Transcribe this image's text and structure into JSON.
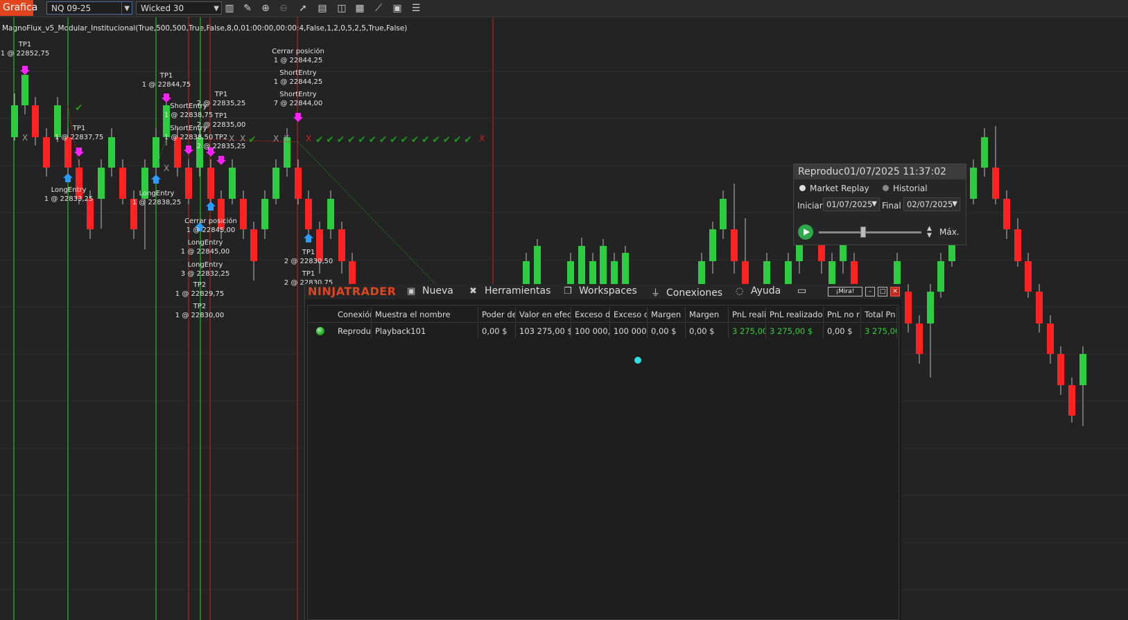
{
  "toolbar": {
    "tab_label": "Grafica",
    "instrument": "NQ 09-25",
    "bar_type": "Wicked 30",
    "icons": [
      "bar-type-icon",
      "draw-pencil-icon",
      "zoom-in-icon",
      "zoom-out-icon",
      "pointer-icon",
      "data-box-icon",
      "templates-icon",
      "properties-icon",
      "indicators-icon",
      "strategies-icon",
      "list-icon"
    ]
  },
  "chart": {
    "indicator_label": "MagnoFlux_v5_Modular_Institucional(True,500,500,True,False,8,0,01:00:00,00:00:4,False,1,2,0,5,2,5,True,False)",
    "colors": {
      "up": "#2ecc40",
      "down": "#ff2222",
      "bg": "#232323",
      "green_line": "#22dd22",
      "red_line": "#cc2222",
      "trail": "#1a8a1a"
    },
    "annotations": [
      {
        "id": "a1",
        "lines": [
          "TP1",
          "1 @ 22852,75"
        ]
      },
      {
        "id": "a2",
        "lines": [
          "TP1",
          "1 @ 22844,75"
        ]
      },
      {
        "id": "a3",
        "lines": [
          "TP1",
          "1 @ 22837,75"
        ]
      },
      {
        "id": "a4",
        "lines": [
          "LongEntry",
          "1 @ 22833,25"
        ]
      },
      {
        "id": "a5",
        "lines": [
          "LongEntry",
          "1 @ 22838,25"
        ]
      },
      {
        "id": "a6",
        "lines": [
          "ShortEntry",
          "1 @ 22838,75"
        ]
      },
      {
        "id": "a7",
        "lines": [
          "ShortEntry",
          "1 @ 22838,50"
        ]
      },
      {
        "id": "a8",
        "lines": [
          "TP1",
          "2 @ 22835,25"
        ]
      },
      {
        "id": "a9",
        "lines": [
          "TP1",
          "2 @ 22835,00"
        ]
      },
      {
        "id": "a10",
        "lines": [
          "TP2",
          "2 @ 22835,25"
        ]
      },
      {
        "id": "a11",
        "lines": [
          "Cerrar posición",
          "1 @ 22844,25"
        ]
      },
      {
        "id": "a12",
        "lines": [
          "ShortEntry",
          "1 @ 22844,25"
        ]
      },
      {
        "id": "a13",
        "lines": [
          "ShortEntry",
          "7 @ 22844,00"
        ]
      },
      {
        "id": "a14",
        "lines": [
          "Cerrar posición",
          "1 @ 22845,00"
        ]
      },
      {
        "id": "a15",
        "lines": [
          "LongEntry",
          "1 @ 22845,00"
        ]
      },
      {
        "id": "a16",
        "lines": [
          "LongEntry",
          "3 @ 22832,25"
        ]
      },
      {
        "id": "a17",
        "lines": [
          "TP2",
          "1 @ 22829,75"
        ]
      },
      {
        "id": "a18",
        "lines": [
          "TP2",
          "1 @ 22830,00"
        ]
      },
      {
        "id": "a19",
        "lines": [
          "TP1",
          "2 @ 22830,50"
        ]
      },
      {
        "id": "a20",
        "lines": [
          "TP1",
          "2 @ 22830,75"
        ]
      }
    ]
  },
  "playback": {
    "title": "Reproduc01/07/2025 11:37:02",
    "mode_market_replay": "Market Replay",
    "mode_historical": "Historial",
    "start_label": "Iniciar",
    "start_date": "01/07/2025",
    "end_label": "Final",
    "end_date": "02/07/2025",
    "speed_label": "Máx."
  },
  "control_center": {
    "brand": "NINJATRADER",
    "menu": [
      {
        "label": "Nueva",
        "icon": "new-icon"
      },
      {
        "label": "Herramientas",
        "icon": "tools-icon"
      },
      {
        "label": "Workspaces",
        "icon": "workspaces-icon"
      },
      {
        "label": "Conexiones",
        "icon": "connections-icon"
      },
      {
        "label": "Ayuda",
        "icon": "help-icon"
      }
    ],
    "mira_label": "¡Mira!",
    "accounts": {
      "headers": [
        "Conexión",
        "Muestra el nombre",
        "Poder de",
        "Valor en efect",
        "Exceso d",
        "Exceso d",
        "Margen",
        "Margen",
        "PnL reali",
        "PnL realizado",
        "PnL no r",
        "Total Pn"
      ],
      "rows": [
        [
          "Reprodu",
          "Playback101",
          "0,00 $",
          "103 275,00 $",
          "100 000,0",
          "100 000,0",
          "0,00 $",
          "0,00 $",
          "3 275,00",
          "3 275,00 $",
          "0,00 $",
          "3 275,00"
        ]
      ]
    }
  }
}
